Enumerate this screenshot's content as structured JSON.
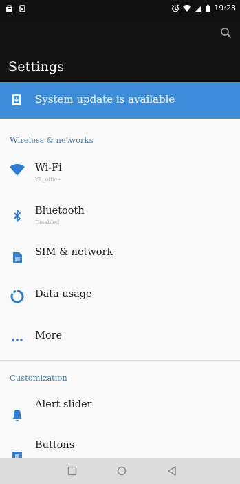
{
  "status_bar": {
    "time": "19:28",
    "icons": [
      "notification-icon",
      "sim-icon",
      "alarm-icon",
      "wifi-signal-icon",
      "cell-signal-icon",
      "battery-icon"
    ]
  },
  "toolbar": {
    "title": "Settings",
    "search_icon": "search-icon"
  },
  "update_banner": {
    "label": "System update is available",
    "icon": "system-update-icon",
    "color": "#3e8ddb"
  },
  "sections": {
    "wireless": {
      "header": "Wireless & networks",
      "items": [
        {
          "title": "Wi-Fi",
          "subtitle": "YL_office",
          "icon": "wifi-icon"
        },
        {
          "title": "Bluetooth",
          "subtitle": "Disabled",
          "icon": "bluetooth-icon"
        },
        {
          "title": "SIM & network",
          "subtitle": "",
          "icon": "sim-card-icon"
        },
        {
          "title": "Data usage",
          "subtitle": "",
          "icon": "data-usage-icon"
        },
        {
          "title": "More",
          "subtitle": "",
          "icon": "more-icon"
        }
      ]
    },
    "customization": {
      "header": "Customization",
      "items": [
        {
          "title": "Alert slider",
          "subtitle": "",
          "icon": "bell-icon"
        },
        {
          "title": "Buttons",
          "subtitle": "",
          "icon": "buttons-icon"
        }
      ]
    }
  },
  "nav_bar": {
    "buttons": [
      "recents-button",
      "home-button",
      "back-button"
    ]
  },
  "colors": {
    "accent": "#3e8ddb",
    "icon_blue": "#2d7fd3",
    "header_text": "#3e78b2",
    "toolbar_bg": "#131313"
  }
}
